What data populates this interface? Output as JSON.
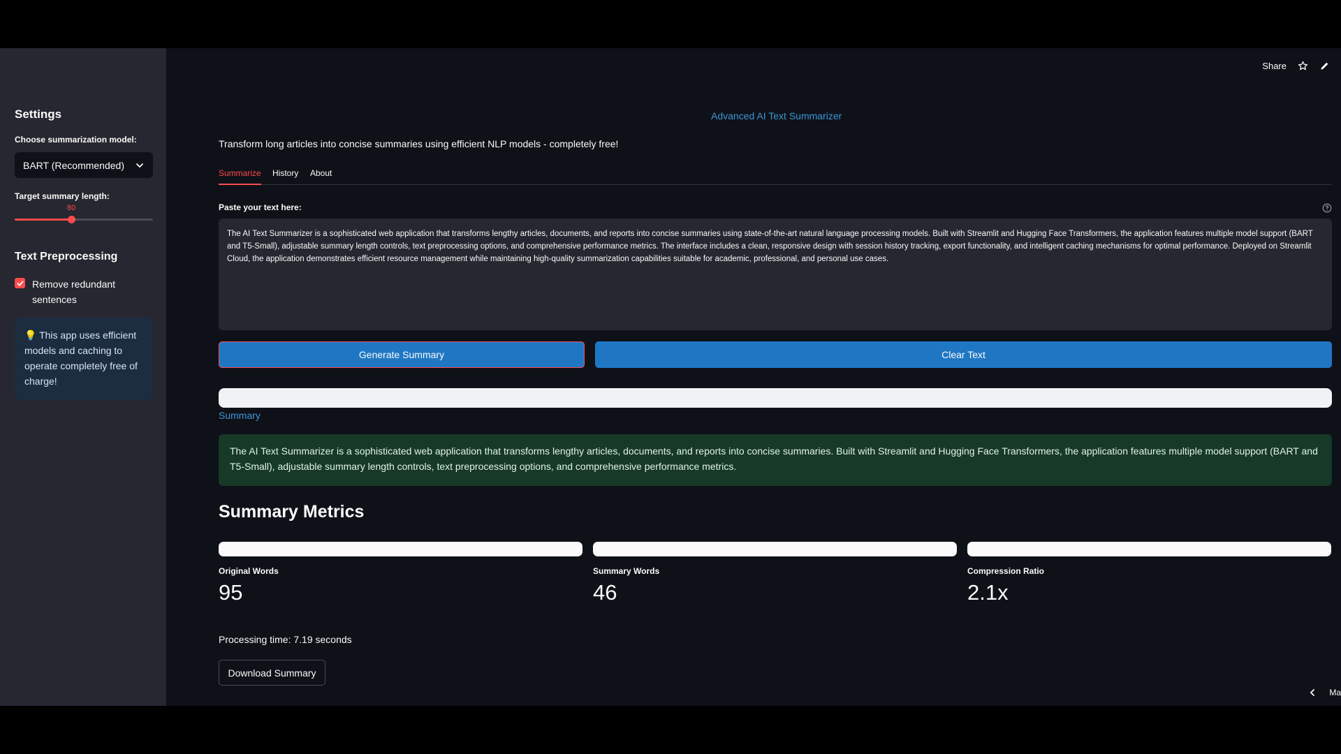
{
  "sidebar": {
    "title": "Settings",
    "model_label": "Choose summarization model:",
    "model_value": "BART (Recommended)",
    "length_label": "Target summary length:",
    "length_value": "80",
    "length_fraction": 0.41,
    "preprocessing_title": "Text Preprocessing",
    "checkbox_label": "Remove redundant sentences",
    "checkbox_checked": true,
    "info_icon": "💡",
    "info_text": "This app uses efficient models and caching to operate completely free of charge!"
  },
  "header": {
    "share": "Share",
    "icons": [
      "star-icon",
      "edit-icon"
    ]
  },
  "main": {
    "title": "Advanced AI Text Summarizer",
    "intro": "Transform long articles into concise summaries using efficient NLP models - completely free!",
    "tabs": [
      {
        "label": "Summarize",
        "active": true
      },
      {
        "label": "History",
        "active": false
      },
      {
        "label": "About",
        "active": false
      }
    ],
    "paste_label": "Paste your text here:",
    "input_text": "The AI Text Summarizer is a sophisticated web application that transforms lengthy articles, documents, and reports into concise summaries using state-of-the-art natural language processing models. Built with Streamlit and Hugging Face Transformers, the application features multiple model support (BART and T5-Small), adjustable summary length controls, text preprocessing options, and comprehensive performance metrics. The interface includes a clean, responsive design with session history tracking, export functionality, and intelligent caching mechanisms for optimal performance. Deployed on Streamlit Cloud, the application demonstrates efficient resource management while maintaining high-quality summarization capabilities suitable for academic, professional, and personal use cases.",
    "generate_button": "Generate Summary",
    "clear_button": "Clear Text",
    "summary_label": "Summary",
    "summary_text": "The AI Text Summarizer is a sophisticated web application that transforms lengthy articles, documents, and reports into concise summaries. Built with Streamlit and Hugging Face Transformers, the application features multiple model support (BART and T5-Small), adjustable summary length controls, text preprocessing options, and comprehensive performance metrics.",
    "metrics_title": "Summary Metrics",
    "metrics": [
      {
        "label": "Original Words",
        "value": "95"
      },
      {
        "label": "Summary Words",
        "value": "46"
      },
      {
        "label": "Compression Ratio",
        "value": "2.1x"
      }
    ],
    "processing_time": "Processing time: 7.19 seconds",
    "download_button": "Download Summary",
    "manage_label": "Ma"
  },
  "colors": {
    "accent": "#ff4b4b",
    "primary_button": "#1f77c4",
    "link": "#3f95d9",
    "success_bg": "#173928"
  }
}
